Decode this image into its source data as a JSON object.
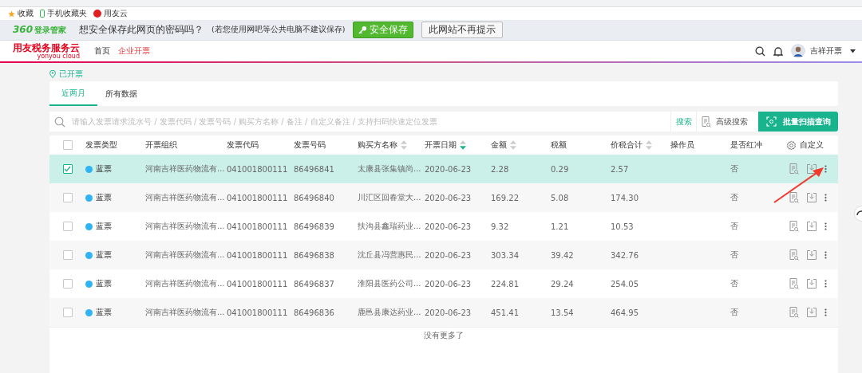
{
  "bookmarks": [
    {
      "label": "收藏",
      "kind": "star"
    },
    {
      "label": "手机收藏夹",
      "kind": "phone"
    },
    {
      "label": "用友云",
      "kind": "site"
    }
  ],
  "password_bar": {
    "brand_number": "360",
    "brand_name": "登录管家",
    "question": "想安全保存此网页的密码吗？",
    "note": "(若您使用网吧等公共电脑不建议保存)",
    "save_button": "安全保存",
    "never_button": "此网站不再提示"
  },
  "header": {
    "logo": "用友税务服务云",
    "logo_sub": "yonyou cloud",
    "nav": [
      {
        "label": "首页",
        "selected": false
      },
      {
        "label": "企业开票",
        "selected": true
      }
    ],
    "user": "吉祥开票"
  },
  "breadcrumb": "已开票",
  "tabs": [
    {
      "label": "近两月",
      "selected": true
    },
    {
      "label": "所有数据",
      "selected": false
    }
  ],
  "search": {
    "placeholder": "请输入发票请求流水号 / 发票代码 / 发票号码 / 购买方名称 / 备注 / 自定义备注 / 支持扫码快速定位发票",
    "search_button": "搜索",
    "advanced_button": "高级搜索",
    "batch_button": "批量扫描查询"
  },
  "table": {
    "all_checked": false,
    "columns": [
      {
        "label": "发票类型",
        "sortable": false,
        "sorted": false
      },
      {
        "label": "开票组织",
        "sortable": false,
        "sorted": false
      },
      {
        "label": "发票代码",
        "sortable": false,
        "sorted": false
      },
      {
        "label": "发票号码",
        "sortable": false,
        "sorted": false
      },
      {
        "label": "购买方名称",
        "sortable": true,
        "sorted": false
      },
      {
        "label": "开票日期",
        "sortable": true,
        "sorted": true
      },
      {
        "label": "金额",
        "sortable": true,
        "sorted": false
      },
      {
        "label": "税额",
        "sortable": false,
        "sorted": false
      },
      {
        "label": "价税合计",
        "sortable": true,
        "sorted": false
      },
      {
        "label": "操作员",
        "sortable": false,
        "sorted": false
      },
      {
        "label": "是否红冲",
        "sortable": false,
        "sorted": false
      }
    ],
    "customize": "自定义",
    "rows": [
      {
        "selected": true,
        "type": "蓝票",
        "org": "河南吉祥医药物流有...",
        "code": "041001800111",
        "number": "86496841",
        "buyer": "太康县张集镇尚...",
        "date": "2020-06-23",
        "amount": "2.28",
        "tax": "0.29",
        "total": "2.57",
        "red": "否"
      },
      {
        "selected": false,
        "type": "蓝票",
        "org": "河南吉祥医药物流有...",
        "code": "041001800111",
        "number": "86496840",
        "buyer": "川汇区回春堂大...",
        "date": "2020-06-23",
        "amount": "169.22",
        "tax": "5.08",
        "total": "174.30",
        "red": "否"
      },
      {
        "selected": false,
        "type": "蓝票",
        "org": "河南吉祥医药物流有...",
        "code": "041001800111",
        "number": "86496839",
        "buyer": "扶沟县鑫瑞药业...",
        "date": "2020-06-23",
        "amount": "9.32",
        "tax": "1.21",
        "total": "10.53",
        "red": "否"
      },
      {
        "selected": false,
        "type": "蓝票",
        "org": "河南吉祥医药物流有...",
        "code": "041001800111",
        "number": "86496838",
        "buyer": "沈丘县冯营惠民...",
        "date": "2020-06-23",
        "amount": "303.34",
        "tax": "39.42",
        "total": "342.76",
        "red": "否"
      },
      {
        "selected": false,
        "type": "蓝票",
        "org": "河南吉祥医药物流有...",
        "code": "041001800111",
        "number": "86496837",
        "buyer": "淮阳县医药公司...",
        "date": "2020-06-23",
        "amount": "224.81",
        "tax": "29.24",
        "total": "254.05",
        "red": "否"
      },
      {
        "selected": false,
        "type": "蓝票",
        "org": "河南吉祥医药物流有...",
        "code": "041001800111",
        "number": "86496836",
        "buyer": "鹿邑县康达药业...",
        "date": "2020-06-23",
        "amount": "451.41",
        "tax": "13.54",
        "total": "464.95",
        "red": "否"
      }
    ],
    "footer": "没有更多了"
  }
}
